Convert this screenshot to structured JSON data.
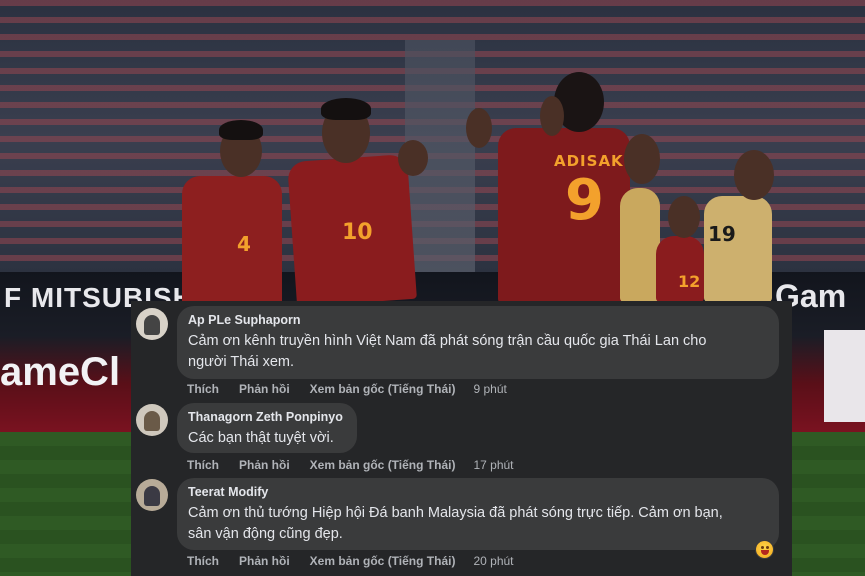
{
  "photo": {
    "jersey_name": "ADISAK",
    "jersey_numbers": [
      "4",
      "10",
      "9",
      "19",
      "12"
    ],
    "board_left": "F MITSUBISHI",
    "board_left_lower": "ameCl",
    "board_right": "Gam"
  },
  "comments": [
    {
      "author": "Ap PLe Suphaporn",
      "text_lines": [
        "Cảm ơn kênh truyền hình Việt Nam đã phát sóng trận cầu quốc gia Thái Lan cho",
        "người Thái xem."
      ],
      "like": "Thích",
      "reply": "Phản hồi",
      "see_original": "Xem bản gốc (Tiếng Thái)",
      "time": "9 phút"
    },
    {
      "author": "Thanagorn Zeth Ponpinyo",
      "text_lines": [
        "Các bạn thật tuyệt vời."
      ],
      "like": "Thích",
      "reply": "Phản hồi",
      "see_original": "Xem bản gốc (Tiếng Thái)",
      "time": "17 phút"
    },
    {
      "author": "Teerat Modify",
      "text_lines": [
        "Cảm ơn thủ tướng Hiệp hội Đá banh Malaysia đã phát sóng trực tiếp. Cảm ơn bạn,",
        "sân vận động cũng đẹp."
      ],
      "like": "Thích",
      "reply": "Phản hồi",
      "see_original": "Xem bản gốc (Tiếng Thái)",
      "time": "20 phút",
      "reaction_icon": "grinning-face-emoji"
    }
  ],
  "colors": {
    "panel_bg": "#252628",
    "bubble_bg": "#3a3b3c",
    "text": "#e4e6eb",
    "meta": "#b0b3b8",
    "thai_jersey": "#8a1c1e",
    "number_gold": "#f3a12c"
  }
}
